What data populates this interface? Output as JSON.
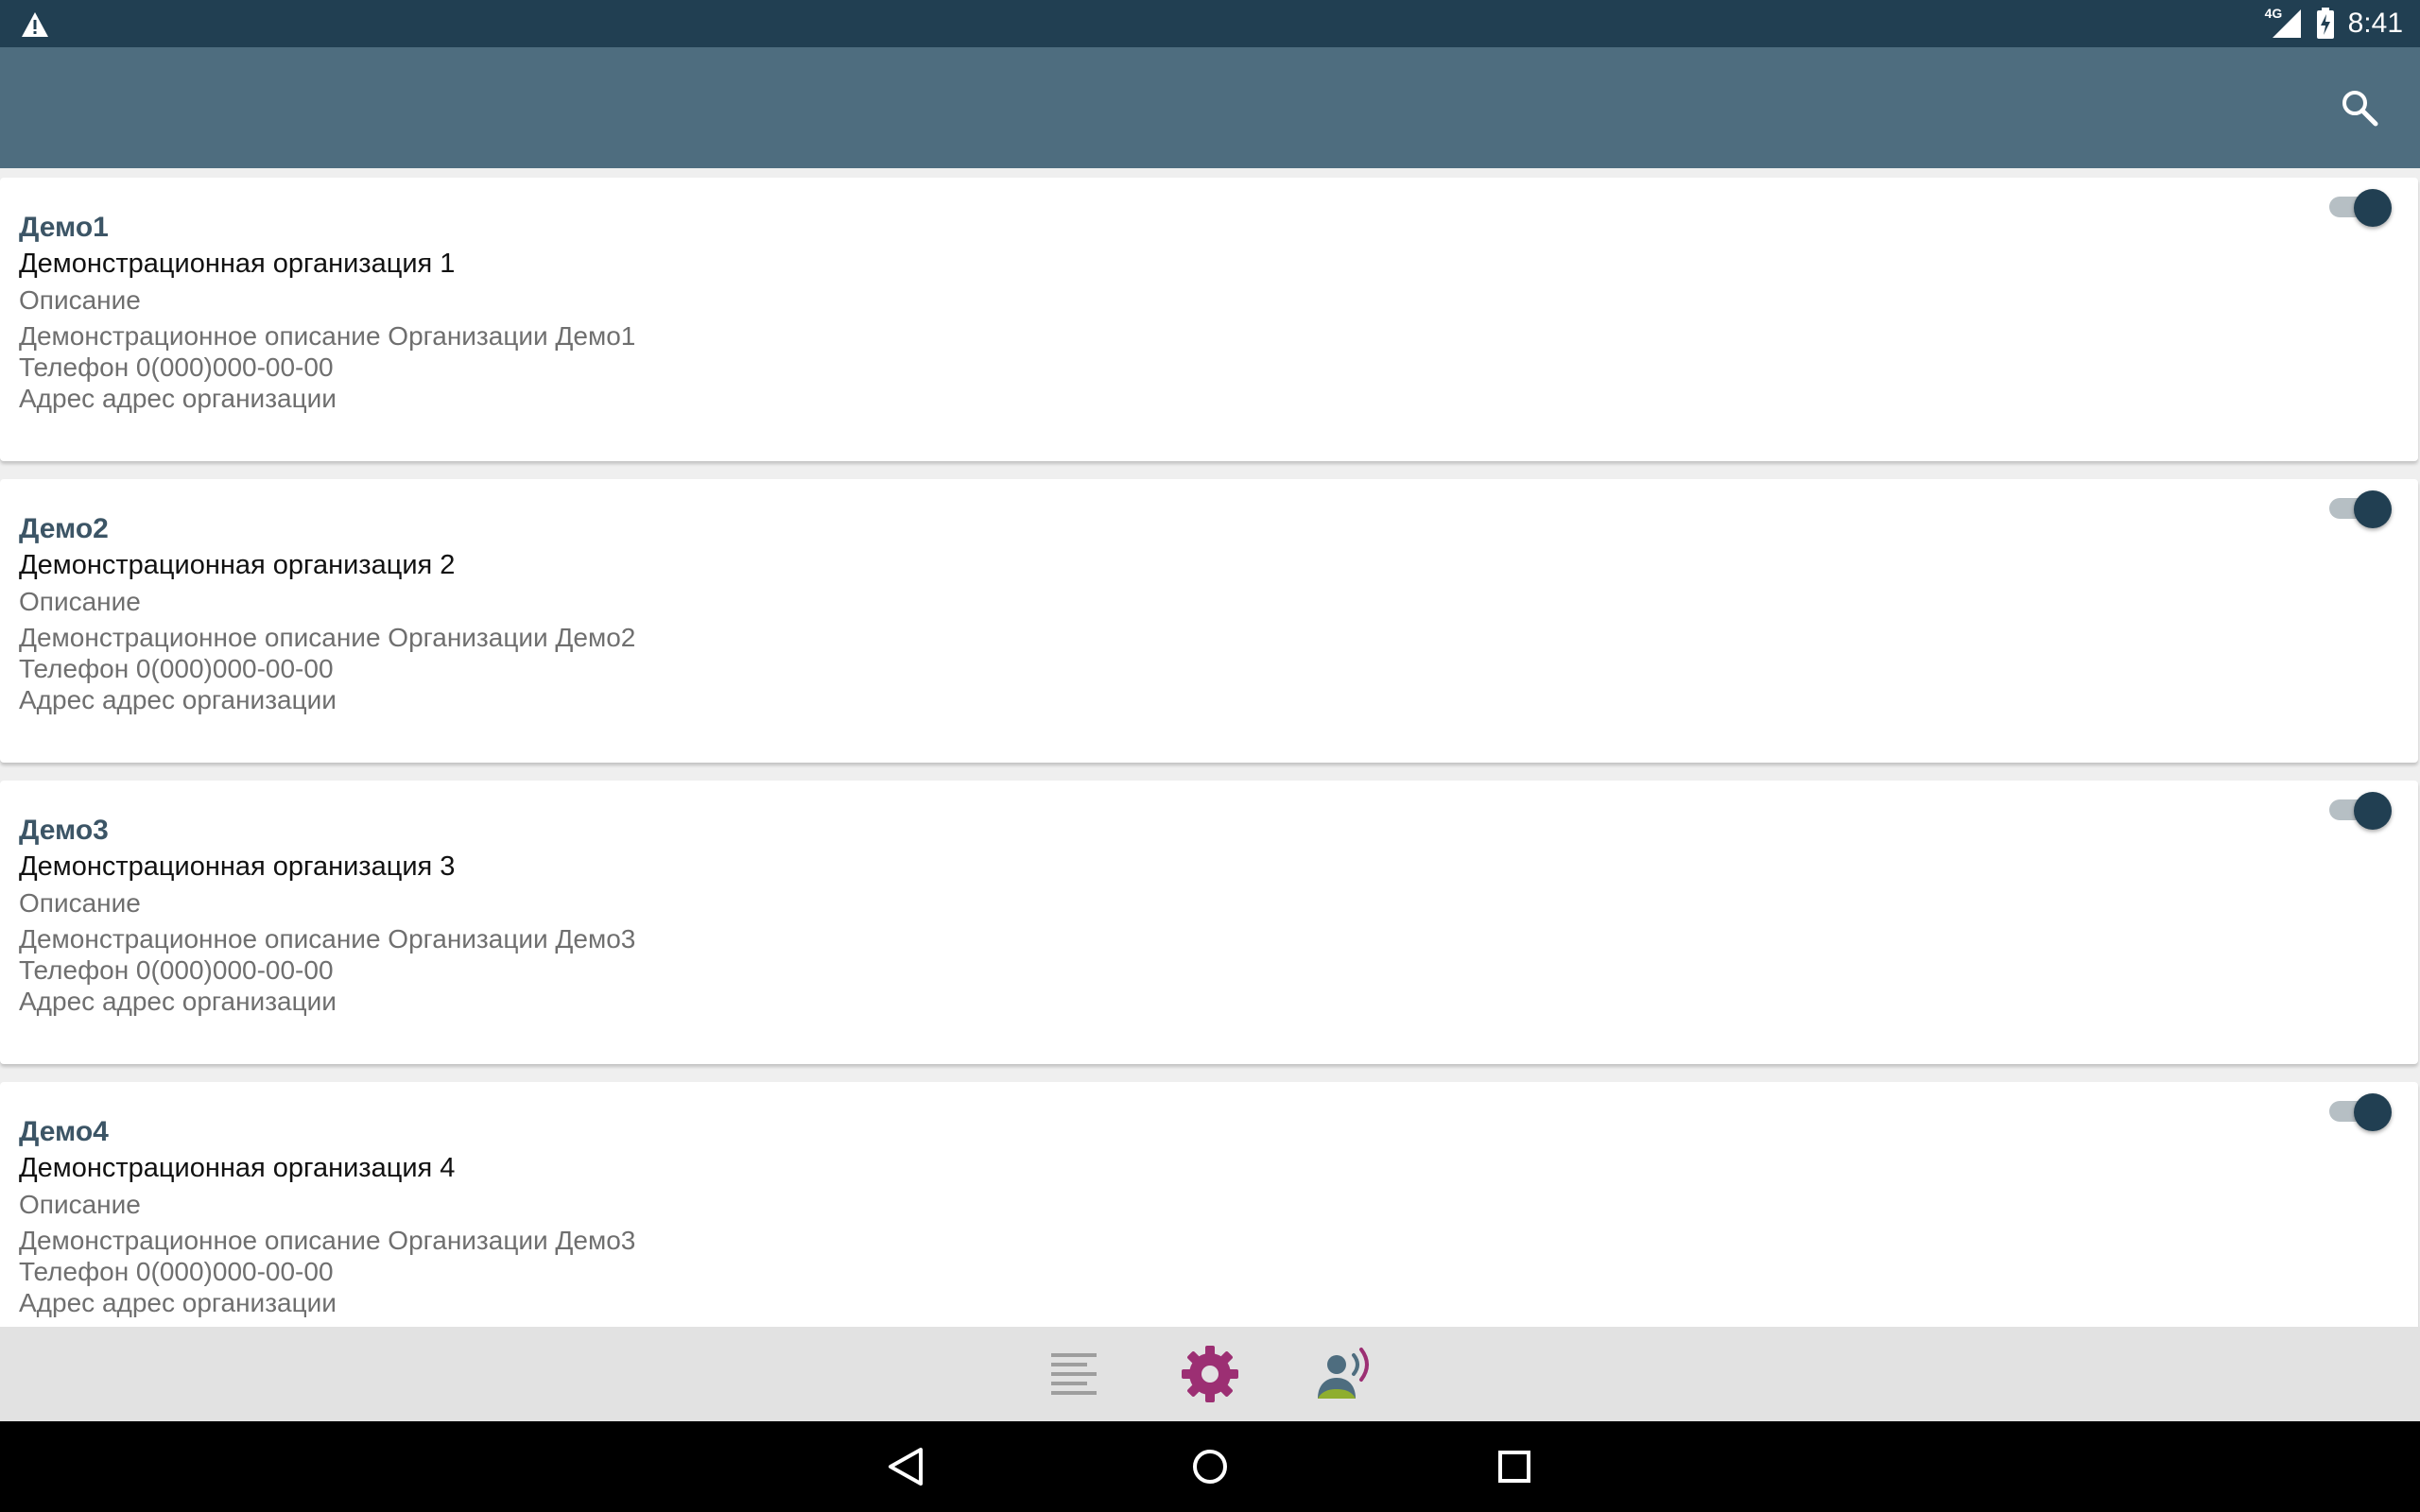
{
  "status_bar": {
    "network": "4G",
    "time": "8:41"
  },
  "app_bar": {
    "icon": "search-icon"
  },
  "organizations": [
    {
      "short_name": "Демо1",
      "full_name": "Демонстрационная организация 1",
      "description_label": "Описание",
      "description": "Демонстрационное описание Организации Демо1",
      "phone": "Телефон 0(000)000-00-00",
      "address": "Адрес адрес организации",
      "enabled": true
    },
    {
      "short_name": "Демо2",
      "full_name": "Демонстрационная организация 2",
      "description_label": "Описание",
      "description": "Демонстрационное описание Организации Демо2",
      "phone": "Телефон 0(000)000-00-00",
      "address": "Адрес адрес организации",
      "enabled": true
    },
    {
      "short_name": "Демо3",
      "full_name": "Демонстрационная организация 3",
      "description_label": "Описание",
      "description": "Демонстрационное описание Организации Демо3",
      "phone": "Телефон 0(000)000-00-00",
      "address": "Адрес адрес организации",
      "enabled": true
    },
    {
      "short_name": "Демо4",
      "full_name": "Демонстрационная организация 4",
      "description_label": "Описание",
      "description": "Демонстрационное описание Организации Демо3",
      "phone": "Телефон 0(000)000-00-00",
      "address": "Адрес адрес организации",
      "enabled": true
    }
  ],
  "bottom_nav": {
    "tabs": [
      "list-icon",
      "settings-gear-icon",
      "voice-contact-icon"
    ],
    "active": "settings-gear-icon",
    "accent_color": "#9c2f73"
  },
  "colors": {
    "status_bar": "#213f52",
    "app_bar": "#4e6d7f",
    "toggle_on": "#213f52"
  }
}
